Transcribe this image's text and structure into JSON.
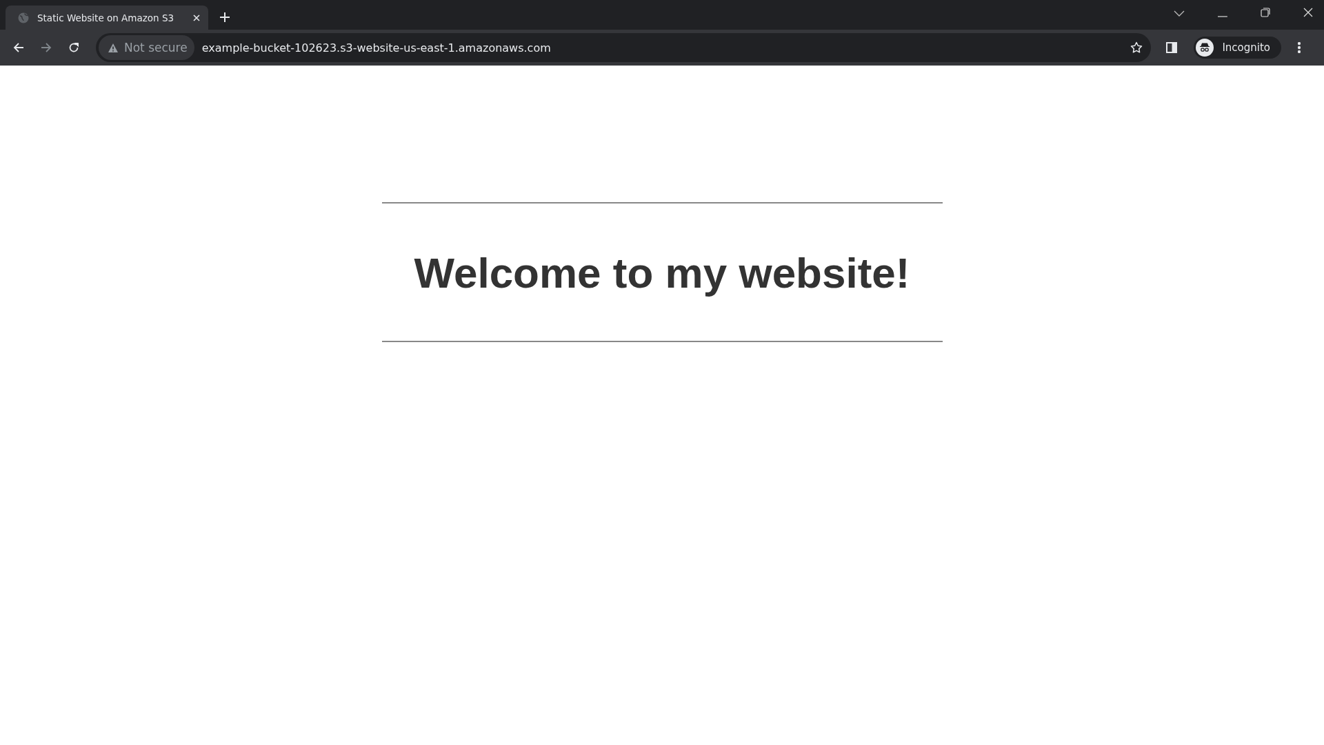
{
  "browser": {
    "tabs": [
      {
        "title": "Static Website on Amazon S3",
        "selected": true
      }
    ],
    "nav": {
      "back_disabled": false,
      "forward_disabled": true
    },
    "security": {
      "label": "Not secure"
    },
    "url": "example-bucket-102623.s3-website-us-east-1.amazonaws.com",
    "profile": {
      "label": "Incognito"
    }
  },
  "page": {
    "heading": "Welcome to my website!"
  }
}
